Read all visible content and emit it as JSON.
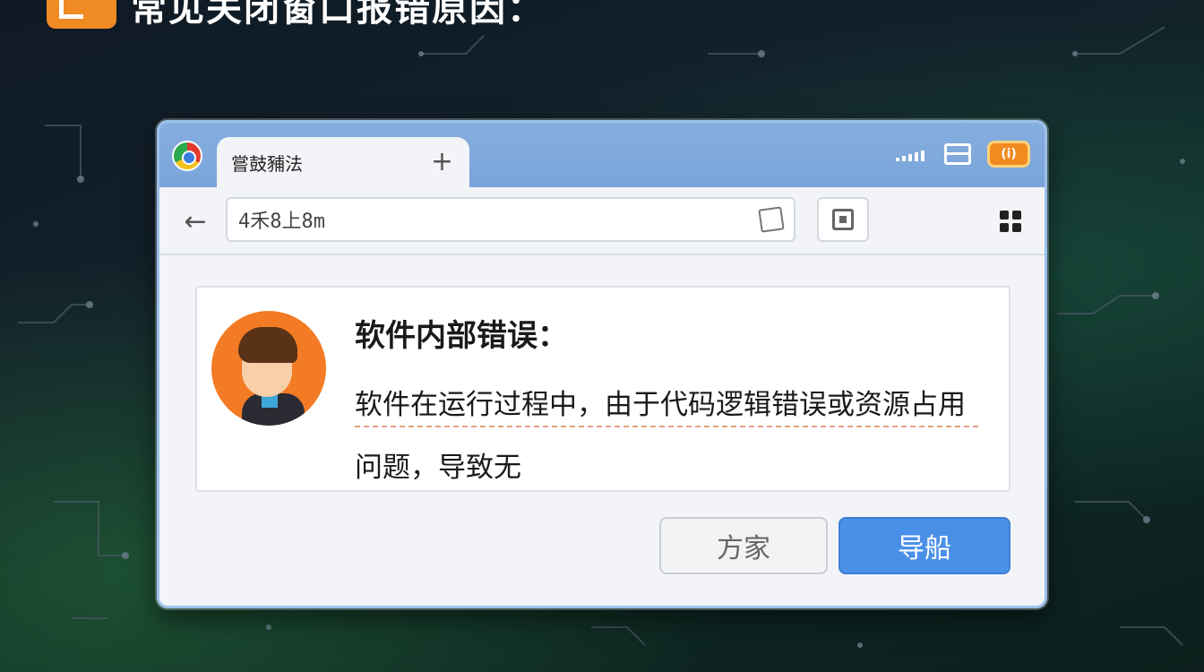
{
  "heading": {
    "icon": "orange-chat-icon",
    "text": "常见关闭窗口报错原因："
  },
  "browser": {
    "tab_title": "嘗鼓豧法",
    "new_tab_symbol": "+",
    "address": "4禾8上8m",
    "ad_badge": "(i)"
  },
  "error": {
    "title": "软件内部错误：",
    "body": "软件在运行过程中，由于代码逻辑错误或资源占用问题，导致无"
  },
  "buttons": {
    "cancel_label": "方家",
    "confirm_label": "导船"
  },
  "colors": {
    "accent": "#4a90e8",
    "titlebar": "#7aa4d9",
    "heading_icon": "#f08a23",
    "avatar_bg": "#f37b25"
  }
}
